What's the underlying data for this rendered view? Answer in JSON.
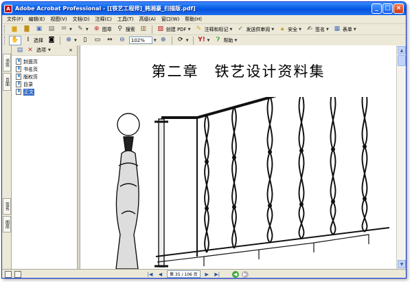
{
  "window": {
    "title": "Adobe Acrobat Professional - [[铁艺工程师]_韩湘豪_扫描版.pdf]",
    "app_icon_letter": "A",
    "controls": {
      "minimize": "_",
      "maximize": "□",
      "close": "×"
    }
  },
  "menu": [
    "文件(F)",
    "编辑(E)",
    "视图(V)",
    "文档(D)",
    "注释(C)",
    "工具(T)",
    "高级(A)",
    "窗口(W)",
    "帮助(H)"
  ],
  "toolbar1": {
    "create_pdf": "创建 PDF",
    "comment_markup": "注释和标记",
    "send_review": "发送供审阅",
    "security": "安全",
    "sign": "签名",
    "forms": "表单",
    "print_label": "图章",
    "search_label": "搜索"
  },
  "toolbar2": {
    "select_label": "选择",
    "zoom_value": "102%",
    "help_label": "帮助"
  },
  "nav_panel": {
    "options_label": "选项",
    "close": "×",
    "bookmarks": [
      "封面页",
      "书名页",
      "版权页",
      "目录",
      "正文"
    ],
    "selected_index": 4,
    "tabs": [
      "书签",
      "页面",
      "签名",
      "图层"
    ]
  },
  "document": {
    "page_title": "第二章　铁艺设计资料集"
  },
  "statusbar": {
    "page_display": "第 35 / 106 页"
  },
  "colors": {
    "titlebar": "#0a5fe8",
    "selection": "#316ac5",
    "chrome": "#ece9d8"
  }
}
